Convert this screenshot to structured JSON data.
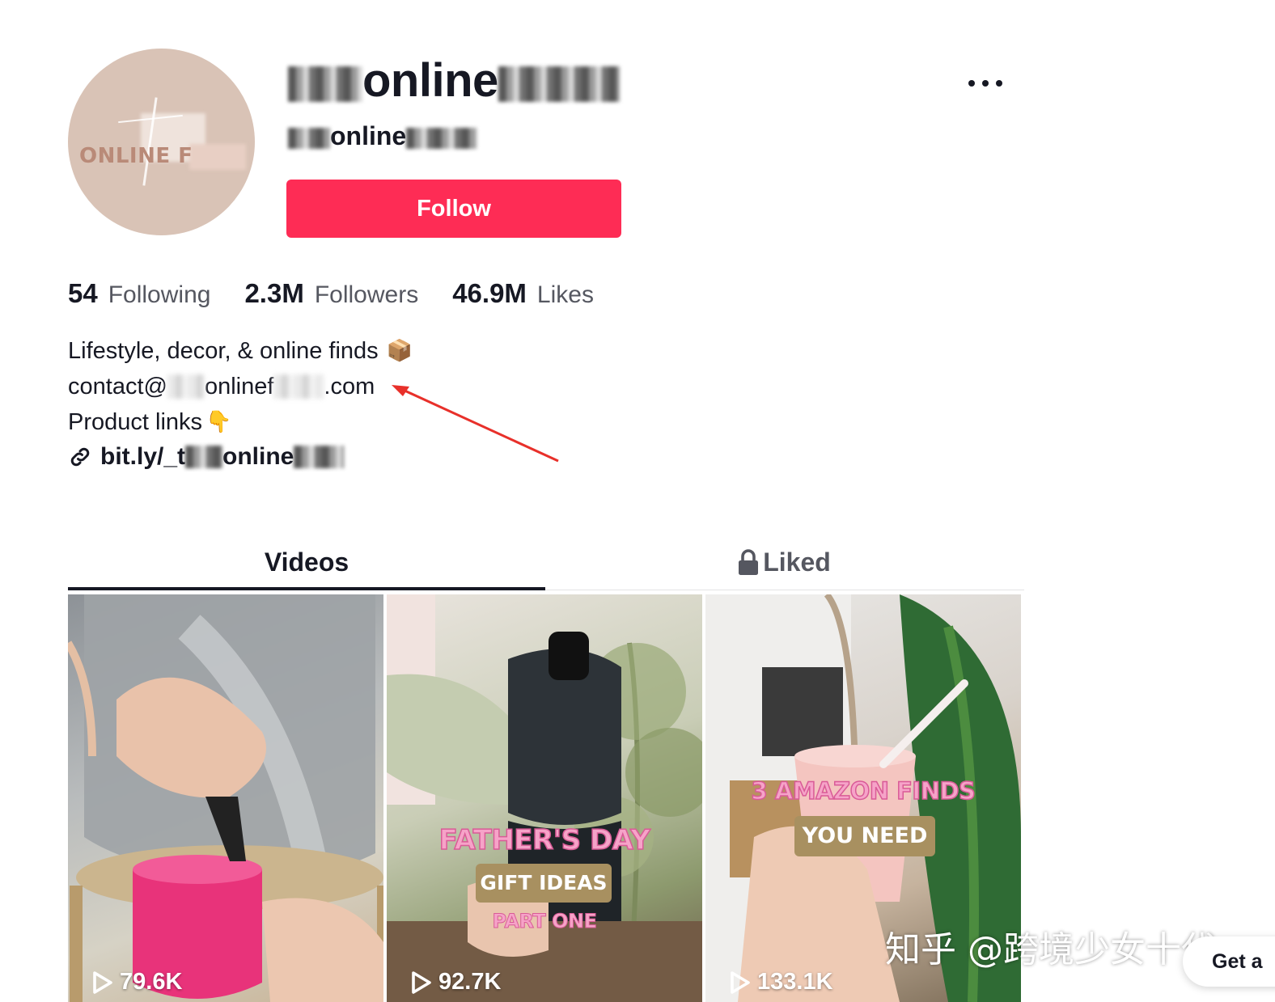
{
  "profile": {
    "display_name": "online",
    "username": "online",
    "avatar_text": "ONLINE F",
    "follow_label": "Follow",
    "more_icon": "more-horizontal-icon"
  },
  "stats": {
    "following_count": "54",
    "following_label": "Following",
    "followers_count": "2.3M",
    "followers_label": "Followers",
    "likes_count": "46.9M",
    "likes_label": "Likes"
  },
  "bio": {
    "line1": "Lifestyle, decor, & online finds",
    "line1_emoji": "📦",
    "email_prefix": "contact@",
    "email_middle": "onlinef",
    "email_suffix": ".com",
    "line3": "Product links",
    "line3_emoji": "👇",
    "link_prefix": "bit.ly/_t",
    "link_middle": "online"
  },
  "tabs": [
    {
      "label": "Videos",
      "active": true
    },
    {
      "label": "Liked",
      "active": false,
      "icon": "lock-icon"
    }
  ],
  "videos": [
    {
      "views": "79.6K"
    },
    {
      "views": "92.7K",
      "overlay_title": "FATHER'S DAY",
      "overlay_pill": "GIFT IDEAS",
      "overlay_sub": "PART ONE"
    },
    {
      "views": "133.1K",
      "overlay_title": "3 AMAZON FINDS",
      "overlay_pill": "YOU NEED"
    }
  ],
  "watermark": "知乎 @跨境少女十代",
  "get_app_label": "Get a",
  "colors": {
    "follow_button": "#fe2c55",
    "text_primary": "#161823",
    "text_secondary": "#555760",
    "annotation_arrow": "#e8302a"
  }
}
